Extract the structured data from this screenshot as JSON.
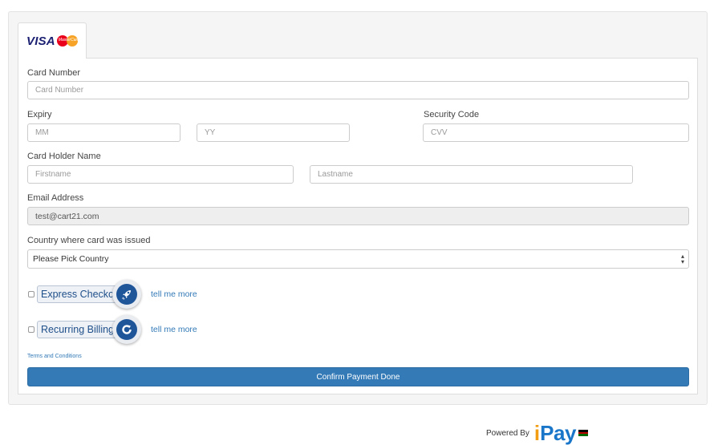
{
  "tab": {
    "brand_visa": "VISA",
    "brand_mastercard": "MasterCard"
  },
  "form": {
    "card_number": {
      "label": "Card Number",
      "placeholder": "Card Number"
    },
    "expiry": {
      "label": "Expiry",
      "month_placeholder": "MM",
      "year_placeholder": "YY"
    },
    "security_code": {
      "label": "Security Code",
      "placeholder": "CVV"
    },
    "card_holder": {
      "label": "Card Holder Name",
      "first_placeholder": "Firstname",
      "last_placeholder": "Lastname"
    },
    "email": {
      "label": "Email Address",
      "value": "test@cart21.com"
    },
    "country": {
      "label": "Country where card was issued",
      "selected": "Please Pick Country"
    }
  },
  "options": {
    "express_checkout": {
      "label": "Express Checkout",
      "link": "tell me more",
      "icon": "rocket-icon"
    },
    "recurring_billing": {
      "label": "Recurring Billing",
      "link": "tell me more",
      "icon": "refresh-icon"
    }
  },
  "terms_link": "Terms and Conditions",
  "confirm_button": "Confirm Payment Done",
  "footer": {
    "powered_by": "Powered By",
    "logo_i": "i",
    "logo_pay": "Pay"
  },
  "colors": {
    "primary": "#337ab7",
    "badge": "#1f5599",
    "logo_orange": "#f29d12",
    "logo_blue": "#1976c9"
  }
}
